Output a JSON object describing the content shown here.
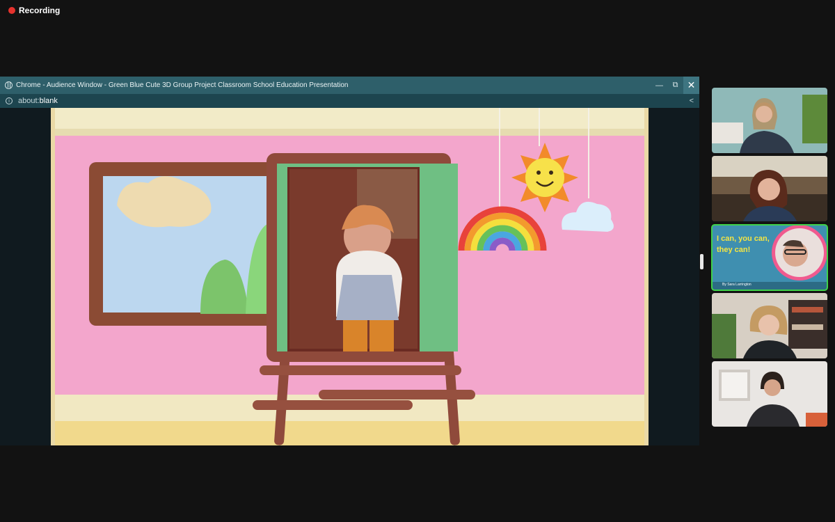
{
  "recording": {
    "label": "Recording"
  },
  "window": {
    "title": "Chrome - Audience Window - Green Blue Cute 3D Group Project Classroom School Education Presentation",
    "url_prefix": "about:",
    "url_host": "blank",
    "minimize_icon": "minimize-icon",
    "restore_icon": "restore-icon",
    "close_icon": "close-icon",
    "share_icon": "share-icon"
  },
  "participants": {
    "active_slide_text": "I can, you can, they can!",
    "active_byline": "By Sara Larrington"
  },
  "colors": {
    "accent_active": "#3fd24a",
    "titlebar": "#2e5f6a",
    "recording": "#e5322d"
  }
}
